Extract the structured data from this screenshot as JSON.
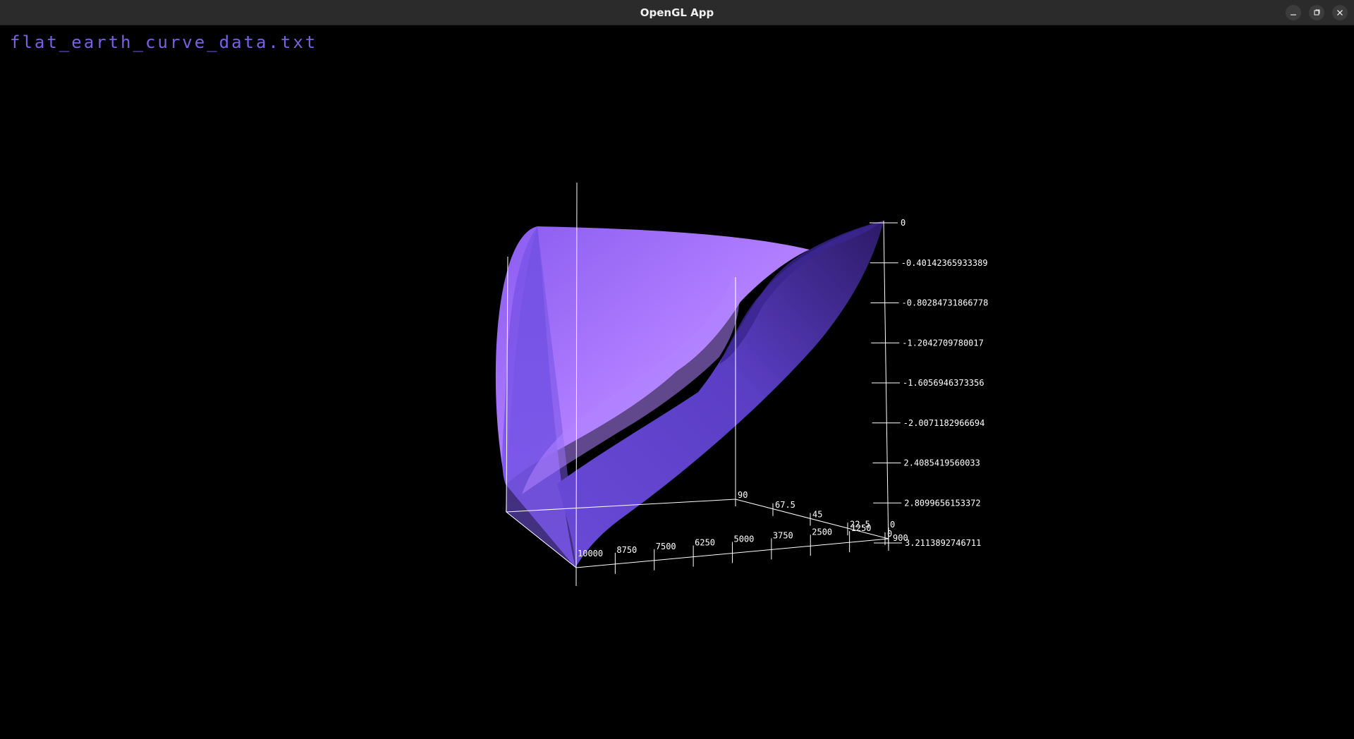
{
  "window": {
    "title": "OpenGL App",
    "buttons": {
      "minimize_icon": "minimize-icon",
      "maximize_icon": "maximize-icon",
      "close_icon": "close-icon"
    }
  },
  "viewport": {
    "filename": "flat_earth_curve_data.txt",
    "label_color": "#7b60e6",
    "surface_color": "#9a6cff",
    "axis_color": "#ffffff"
  },
  "chart_data": {
    "type": "surface",
    "x_ticks": [
      "10000",
      "8750",
      "7500",
      "6250",
      "5000",
      "3750",
      "2500",
      "1250",
      "0"
    ],
    "y_ticks": [
      "90",
      "67.5",
      "45",
      "22.5",
      "0"
    ],
    "y_ticks_near_axis": [
      "90",
      "67.5",
      "45",
      "22.5",
      "0",
      "90"
    ],
    "z_ticks": [
      "0",
      "-0.40142365933389",
      "-0.80284731866778",
      "-1.2042709780017",
      "-1.6056946373356",
      "-2.0071182966694",
      "2.4085419560033",
      "2.8099656153372",
      "3.2113892746711"
    ],
    "z_range": [
      -3.2113892746711,
      0
    ],
    "x_range": [
      0,
      10000
    ],
    "y_range": [
      0,
      90
    ]
  }
}
